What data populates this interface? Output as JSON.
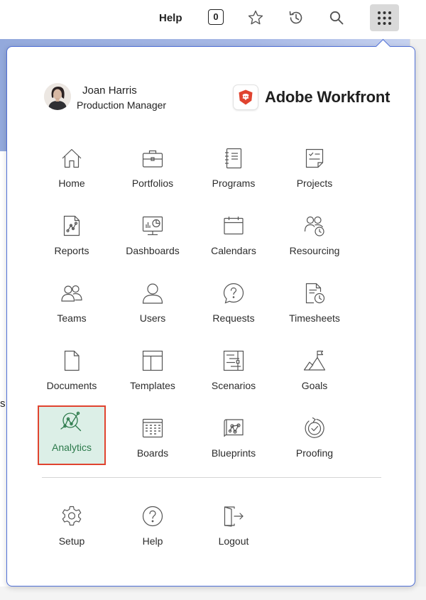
{
  "topbar": {
    "help_label": "Help",
    "count": "0",
    "icons": [
      "star-icon",
      "history-icon",
      "search-icon",
      "apps-grid-icon"
    ]
  },
  "background": {
    "partial_text": "s"
  },
  "menu": {
    "user": {
      "name": "Joan Harris",
      "role": "Production Manager"
    },
    "brand": {
      "name": "Adobe Workfront",
      "logo_color": "#e0432f"
    },
    "items": [
      {
        "label": "Home",
        "icon": "home-icon"
      },
      {
        "label": "Portfolios",
        "icon": "briefcase-icon"
      },
      {
        "label": "Programs",
        "icon": "notebook-icon"
      },
      {
        "label": "Projects",
        "icon": "checklist-icon"
      },
      {
        "label": "Reports",
        "icon": "report-icon"
      },
      {
        "label": "Dashboards",
        "icon": "dashboard-icon"
      },
      {
        "label": "Calendars",
        "icon": "calendar-icon"
      },
      {
        "label": "Resourcing",
        "icon": "resourcing-icon"
      },
      {
        "label": "Teams",
        "icon": "team-icon"
      },
      {
        "label": "Users",
        "icon": "user-icon"
      },
      {
        "label": "Requests",
        "icon": "request-icon"
      },
      {
        "label": "Timesheets",
        "icon": "timesheet-icon"
      },
      {
        "label": "Documents",
        "icon": "document-icon"
      },
      {
        "label": "Templates",
        "icon": "template-icon"
      },
      {
        "label": "Scenarios",
        "icon": "scenario-icon"
      },
      {
        "label": "Goals",
        "icon": "goal-flag-icon"
      },
      {
        "label": "Analytics",
        "icon": "analytics-icon",
        "selected": true
      },
      {
        "label": "Boards",
        "icon": "board-icon"
      },
      {
        "label": "Blueprints",
        "icon": "blueprint-icon"
      },
      {
        "label": "Proofing",
        "icon": "proofing-icon"
      }
    ],
    "footer_items": [
      {
        "label": "Setup",
        "icon": "gear-icon"
      },
      {
        "label": "Help",
        "icon": "help-icon"
      },
      {
        "label": "Logout",
        "icon": "logout-icon"
      }
    ],
    "colors": {
      "menu_border": "#4f6fd6",
      "selected_bg": "#dcefe7",
      "selected_text": "#2c7a4b",
      "highlight_border": "#e0432f"
    }
  }
}
